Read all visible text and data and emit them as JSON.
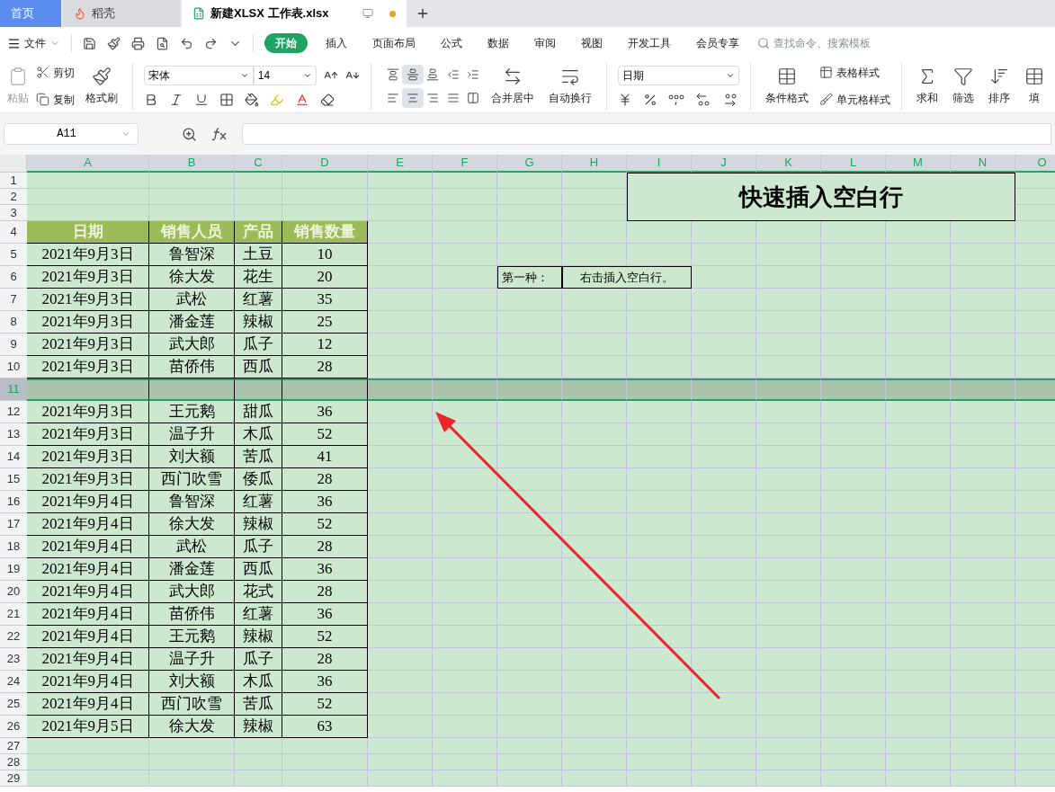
{
  "tabs": [
    {
      "label": "首页",
      "selected": false,
      "kind": "home"
    },
    {
      "label": "稻壳",
      "selected": false,
      "kind": "docer"
    },
    {
      "label": "新建XLSX 工作表.xlsx",
      "selected": true,
      "kind": "sheet",
      "unsaved": true
    }
  ],
  "menu": {
    "file": "文件",
    "ribbon_tabs": [
      {
        "label": "开始",
        "selected": true
      },
      {
        "label": "插入",
        "selected": false
      },
      {
        "label": "页面布局",
        "selected": false
      },
      {
        "label": "公式",
        "selected": false
      },
      {
        "label": "数据",
        "selected": false
      },
      {
        "label": "审阅",
        "selected": false
      },
      {
        "label": "视图",
        "selected": false
      },
      {
        "label": "开发工具",
        "selected": false
      },
      {
        "label": "会员专享",
        "selected": false
      }
    ],
    "search": {
      "placeholder": "查找命令、搜索模板"
    }
  },
  "ribbon": {
    "paste": "粘贴",
    "cut": "剪切",
    "copy": "复制",
    "format_painter": "格式刷",
    "font_name": "宋体",
    "font_size": "14",
    "align_buttons": [
      {
        "kind": "top",
        "selected": false
      },
      {
        "kind": "middle",
        "selected": true
      },
      {
        "kind": "bottom",
        "selected": false
      },
      {
        "kind": "outdent",
        "selected": false
      },
      {
        "kind": "indent",
        "selected": false
      },
      {
        "kind": "left",
        "selected": false
      },
      {
        "kind": "center",
        "selected": true
      },
      {
        "kind": "right",
        "selected": false
      },
      {
        "kind": "justify",
        "selected": false
      },
      {
        "kind": "distributed",
        "selected": false
      }
    ],
    "merge": "合并居中",
    "wrap": "自动换行",
    "number_format": "日期",
    "conditional_format": "条件格式",
    "table_style": "表格样式",
    "cell_style": "单元格样式",
    "sum": "求和",
    "filter": "筛选",
    "sort": "排序",
    "fill": "填"
  },
  "formula_bar": {
    "name_box": "A11"
  },
  "sheet": {
    "columns": [
      "A",
      "B",
      "C",
      "D",
      "E",
      "F",
      "G",
      "H",
      "I",
      "J",
      "K",
      "L",
      "M",
      "N",
      "O"
    ],
    "title": "快速插入空白行",
    "note_label": "第一种：",
    "note_text": "右击插入空白行。",
    "rows": [
      {
        "number": "1",
        "selected": false
      },
      {
        "number": "2",
        "selected": false
      },
      {
        "number": "3",
        "selected": false
      },
      {
        "number": "4",
        "selected": false,
        "kind": "header",
        "cells": [
          "日期",
          "销售人员",
          "产品",
          "销售数量"
        ]
      },
      {
        "number": "5",
        "selected": false,
        "cells": [
          "2021年9月3日",
          "鲁智深",
          "土豆",
          "10"
        ]
      },
      {
        "number": "6",
        "selected": false,
        "cells": [
          "2021年9月3日",
          "徐大发",
          "花生",
          "20"
        ]
      },
      {
        "number": "7",
        "selected": false,
        "cells": [
          "2021年9月3日",
          "武松",
          "红薯",
          "35"
        ]
      },
      {
        "number": "8",
        "selected": false,
        "cells": [
          "2021年9月3日",
          "潘金莲",
          "辣椒",
          "25"
        ]
      },
      {
        "number": "9",
        "selected": false,
        "cells": [
          "2021年9月3日",
          "武大郎",
          "瓜子",
          "12"
        ]
      },
      {
        "number": "10",
        "selected": false,
        "cells": [
          "2021年9月3日",
          "苗侨伟",
          "西瓜",
          "28"
        ]
      },
      {
        "number": "11",
        "selected": true,
        "kind": "blank"
      },
      {
        "number": "12",
        "selected": false,
        "cells": [
          "2021年9月3日",
          "王元鹅",
          "甜瓜",
          "36"
        ]
      },
      {
        "number": "13",
        "selected": false,
        "cells": [
          "2021年9月3日",
          "温子升",
          "木瓜",
          "52"
        ]
      },
      {
        "number": "14",
        "selected": false,
        "cells": [
          "2021年9月3日",
          "刘大额",
          "苦瓜",
          "41"
        ]
      },
      {
        "number": "15",
        "selected": false,
        "cells": [
          "2021年9月3日",
          "西门吹雪",
          "倭瓜",
          "28"
        ]
      },
      {
        "number": "16",
        "selected": false,
        "cells": [
          "2021年9月4日",
          "鲁智深",
          "红薯",
          "36"
        ]
      },
      {
        "number": "17",
        "selected": false,
        "cells": [
          "2021年9月4日",
          "徐大发",
          "辣椒",
          "52"
        ]
      },
      {
        "number": "18",
        "selected": false,
        "cells": [
          "2021年9月4日",
          "武松",
          "瓜子",
          "28"
        ]
      },
      {
        "number": "19",
        "selected": false,
        "cells": [
          "2021年9月4日",
          "潘金莲",
          "西瓜",
          "36"
        ]
      },
      {
        "number": "20",
        "selected": false,
        "cells": [
          "2021年9月4日",
          "武大郎",
          "花式",
          "28"
        ]
      },
      {
        "number": "21",
        "selected": false,
        "cells": [
          "2021年9月4日",
          "苗侨伟",
          "红薯",
          "36"
        ]
      },
      {
        "number": "22",
        "selected": false,
        "cells": [
          "2021年9月4日",
          "王元鹅",
          "辣椒",
          "52"
        ]
      },
      {
        "number": "23",
        "selected": false,
        "cells": [
          "2021年9月4日",
          "温子升",
          "瓜子",
          "28"
        ]
      },
      {
        "number": "24",
        "selected": false,
        "cells": [
          "2021年9月4日",
          "刘大额",
          "木瓜",
          "36"
        ]
      },
      {
        "number": "25",
        "selected": false,
        "cells": [
          "2021年9月4日",
          "西门吹雪",
          "苦瓜",
          "52"
        ]
      },
      {
        "number": "26",
        "selected": false,
        "cells": [
          "2021年9月5日",
          "徐大发",
          "辣椒",
          "63"
        ]
      },
      {
        "number": "27",
        "selected": false
      },
      {
        "number": "28",
        "selected": false
      },
      {
        "number": "29",
        "selected": false
      }
    ]
  }
}
